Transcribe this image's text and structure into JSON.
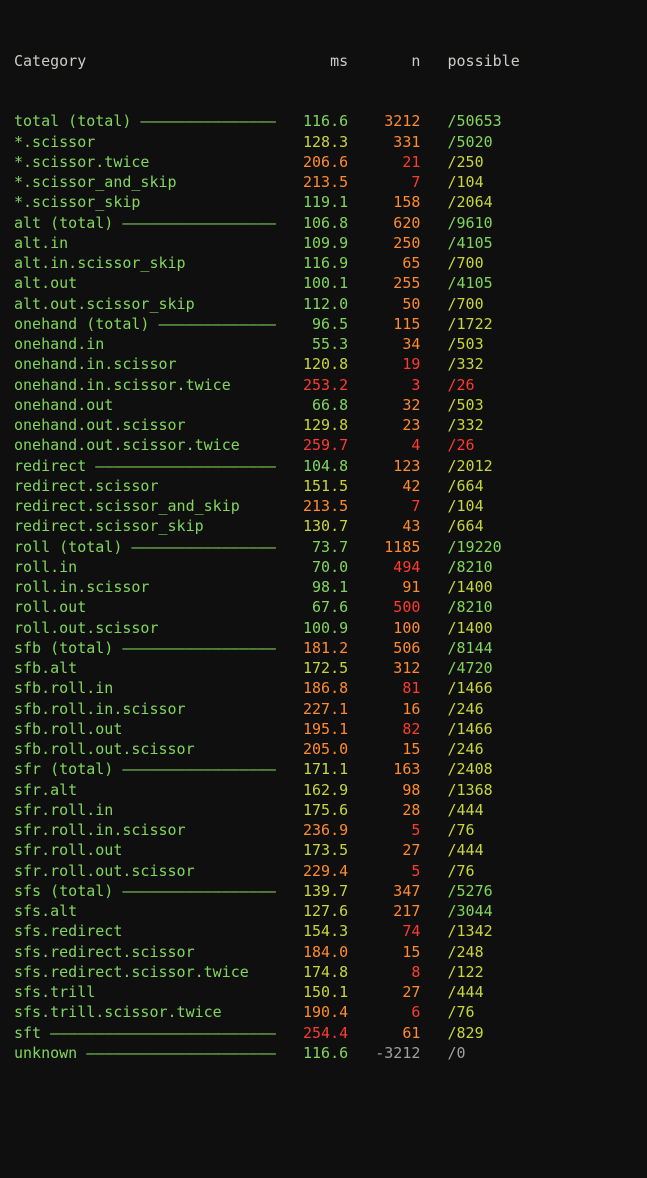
{
  "header": {
    "category": "Category",
    "ms": "ms",
    "n": "n",
    "possible": "possible"
  },
  "layout": {
    "catWidth": 29,
    "msWidth": 8,
    "nWidth": 8,
    "possPad": 3,
    "dashChar": "–"
  },
  "rows": [
    {
      "cat": "total (total)",
      "dash": true,
      "ms": "116.6",
      "msc": "#81d65c",
      "n": "3212",
      "nc": "#ff8b2e",
      "p": "/50653",
      "pc": "#81d65c"
    },
    {
      "cat": "*.scissor",
      "dash": false,
      "ms": "128.3",
      "msc": "#c9d63a",
      "n": "331",
      "nc": "#ff8b2e",
      "p": "/5020",
      "pc": "#81d65c"
    },
    {
      "cat": "*.scissor.twice",
      "dash": false,
      "ms": "206.6",
      "msc": "#ff8b2e",
      "n": "21",
      "nc": "#ff3b2e",
      "p": "/250",
      "pc": "#c9d63a"
    },
    {
      "cat": "*.scissor_and_skip",
      "dash": false,
      "ms": "213.5",
      "msc": "#ff8b2e",
      "n": "7",
      "nc": "#ff3b2e",
      "p": "/104",
      "pc": "#c9d63a"
    },
    {
      "cat": "*.scissor_skip",
      "dash": false,
      "ms": "119.1",
      "msc": "#81d65c",
      "n": "158",
      "nc": "#ff8b2e",
      "p": "/2064",
      "pc": "#c9d63a"
    },
    {
      "cat": "alt (total)",
      "dash": true,
      "ms": "106.8",
      "msc": "#81d65c",
      "n": "620",
      "nc": "#ff8b2e",
      "p": "/9610",
      "pc": "#81d65c"
    },
    {
      "cat": "alt.in",
      "dash": false,
      "ms": "109.9",
      "msc": "#81d65c",
      "n": "250",
      "nc": "#ff8b2e",
      "p": "/4105",
      "pc": "#81d65c"
    },
    {
      "cat": "alt.in.scissor_skip",
      "dash": false,
      "ms": "116.9",
      "msc": "#81d65c",
      "n": "65",
      "nc": "#ff8b2e",
      "p": "/700",
      "pc": "#c9d63a"
    },
    {
      "cat": "alt.out",
      "dash": false,
      "ms": "100.1",
      "msc": "#81d65c",
      "n": "255",
      "nc": "#ff8b2e",
      "p": "/4105",
      "pc": "#81d65c"
    },
    {
      "cat": "alt.out.scissor_skip",
      "dash": false,
      "ms": "112.0",
      "msc": "#81d65c",
      "n": "50",
      "nc": "#ff8b2e",
      "p": "/700",
      "pc": "#c9d63a"
    },
    {
      "cat": "onehand (total)",
      "dash": true,
      "ms": "96.5",
      "msc": "#81d65c",
      "n": "115",
      "nc": "#ff8b2e",
      "p": "/1722",
      "pc": "#c9d63a"
    },
    {
      "cat": "onehand.in",
      "dash": false,
      "ms": "55.3",
      "msc": "#81d65c",
      "n": "34",
      "nc": "#ff8b2e",
      "p": "/503",
      "pc": "#c9d63a"
    },
    {
      "cat": "onehand.in.scissor",
      "dash": false,
      "ms": "120.8",
      "msc": "#c9d63a",
      "n": "19",
      "nc": "#ff3b2e",
      "p": "/332",
      "pc": "#c9d63a"
    },
    {
      "cat": "onehand.in.scissor.twice",
      "dash": false,
      "ms": "253.2",
      "msc": "#ff3b2e",
      "n": "3",
      "nc": "#ff3b2e",
      "p": "/26",
      "pc": "#ff3b2e"
    },
    {
      "cat": "onehand.out",
      "dash": false,
      "ms": "66.8",
      "msc": "#81d65c",
      "n": "32",
      "nc": "#ff8b2e",
      "p": "/503",
      "pc": "#c9d63a"
    },
    {
      "cat": "onehand.out.scissor",
      "dash": false,
      "ms": "129.8",
      "msc": "#c9d63a",
      "n": "23",
      "nc": "#ff8b2e",
      "p": "/332",
      "pc": "#c9d63a"
    },
    {
      "cat": "onehand.out.scissor.twice",
      "dash": false,
      "ms": "259.7",
      "msc": "#ff3b2e",
      "n": "4",
      "nc": "#ff3b2e",
      "p": "/26",
      "pc": "#ff3b2e"
    },
    {
      "cat": "redirect",
      "dash": true,
      "ms": "104.8",
      "msc": "#81d65c",
      "n": "123",
      "nc": "#ff8b2e",
      "p": "/2012",
      "pc": "#c9d63a"
    },
    {
      "cat": "redirect.scissor",
      "dash": false,
      "ms": "151.5",
      "msc": "#c9d63a",
      "n": "42",
      "nc": "#ff8b2e",
      "p": "/664",
      "pc": "#c9d63a"
    },
    {
      "cat": "redirect.scissor_and_skip",
      "dash": false,
      "ms": "213.5",
      "msc": "#ff8b2e",
      "n": "7",
      "nc": "#ff3b2e",
      "p": "/104",
      "pc": "#c9d63a"
    },
    {
      "cat": "redirect.scissor_skip",
      "dash": false,
      "ms": "130.7",
      "msc": "#c9d63a",
      "n": "43",
      "nc": "#ff8b2e",
      "p": "/664",
      "pc": "#c9d63a"
    },
    {
      "cat": "roll (total)",
      "dash": true,
      "ms": "73.7",
      "msc": "#81d65c",
      "n": "1185",
      "nc": "#ff8b2e",
      "p": "/19220",
      "pc": "#81d65c"
    },
    {
      "cat": "roll.in",
      "dash": false,
      "ms": "70.0",
      "msc": "#81d65c",
      "n": "494",
      "nc": "#ff3b2e",
      "p": "/8210",
      "pc": "#81d65c"
    },
    {
      "cat": "roll.in.scissor",
      "dash": false,
      "ms": "98.1",
      "msc": "#81d65c",
      "n": "91",
      "nc": "#ff8b2e",
      "p": "/1400",
      "pc": "#c9d63a"
    },
    {
      "cat": "roll.out",
      "dash": false,
      "ms": "67.6",
      "msc": "#81d65c",
      "n": "500",
      "nc": "#ff3b2e",
      "p": "/8210",
      "pc": "#81d65c"
    },
    {
      "cat": "roll.out.scissor",
      "dash": false,
      "ms": "100.9",
      "msc": "#81d65c",
      "n": "100",
      "nc": "#ff8b2e",
      "p": "/1400",
      "pc": "#c9d63a"
    },
    {
      "cat": "sfb (total)",
      "dash": true,
      "ms": "181.2",
      "msc": "#ff8b2e",
      "n": "506",
      "nc": "#ff8b2e",
      "p": "/8144",
      "pc": "#81d65c"
    },
    {
      "cat": "sfb.alt",
      "dash": false,
      "ms": "172.5",
      "msc": "#c9d63a",
      "n": "312",
      "nc": "#ff8b2e",
      "p": "/4720",
      "pc": "#81d65c"
    },
    {
      "cat": "sfb.roll.in",
      "dash": false,
      "ms": "186.8",
      "msc": "#ff8b2e",
      "n": "81",
      "nc": "#ff3b2e",
      "p": "/1466",
      "pc": "#c9d63a"
    },
    {
      "cat": "sfb.roll.in.scissor",
      "dash": false,
      "ms": "227.1",
      "msc": "#ff8b2e",
      "n": "16",
      "nc": "#ff8b2e",
      "p": "/246",
      "pc": "#c9d63a"
    },
    {
      "cat": "sfb.roll.out",
      "dash": false,
      "ms": "195.1",
      "msc": "#ff8b2e",
      "n": "82",
      "nc": "#ff3b2e",
      "p": "/1466",
      "pc": "#c9d63a"
    },
    {
      "cat": "sfb.roll.out.scissor",
      "dash": false,
      "ms": "205.0",
      "msc": "#ff8b2e",
      "n": "15",
      "nc": "#ff8b2e",
      "p": "/246",
      "pc": "#c9d63a"
    },
    {
      "cat": "sfr (total)",
      "dash": true,
      "ms": "171.1",
      "msc": "#c9d63a",
      "n": "163",
      "nc": "#ff8b2e",
      "p": "/2408",
      "pc": "#c9d63a"
    },
    {
      "cat": "sfr.alt",
      "dash": false,
      "ms": "162.9",
      "msc": "#c9d63a",
      "n": "98",
      "nc": "#ff8b2e",
      "p": "/1368",
      "pc": "#c9d63a"
    },
    {
      "cat": "sfr.roll.in",
      "dash": false,
      "ms": "175.6",
      "msc": "#c9d63a",
      "n": "28",
      "nc": "#ff8b2e",
      "p": "/444",
      "pc": "#c9d63a"
    },
    {
      "cat": "sfr.roll.in.scissor",
      "dash": false,
      "ms": "236.9",
      "msc": "#ff8b2e",
      "n": "5",
      "nc": "#ff3b2e",
      "p": "/76",
      "pc": "#c9d63a"
    },
    {
      "cat": "sfr.roll.out",
      "dash": false,
      "ms": "173.5",
      "msc": "#c9d63a",
      "n": "27",
      "nc": "#ff8b2e",
      "p": "/444",
      "pc": "#c9d63a"
    },
    {
      "cat": "sfr.roll.out.scissor",
      "dash": false,
      "ms": "229.4",
      "msc": "#ff8b2e",
      "n": "5",
      "nc": "#ff3b2e",
      "p": "/76",
      "pc": "#c9d63a"
    },
    {
      "cat": "sfs (total)",
      "dash": true,
      "ms": "139.7",
      "msc": "#c9d63a",
      "n": "347",
      "nc": "#ff8b2e",
      "p": "/5276",
      "pc": "#81d65c"
    },
    {
      "cat": "sfs.alt",
      "dash": false,
      "ms": "127.6",
      "msc": "#c9d63a",
      "n": "217",
      "nc": "#ff8b2e",
      "p": "/3044",
      "pc": "#81d65c"
    },
    {
      "cat": "sfs.redirect",
      "dash": false,
      "ms": "154.3",
      "msc": "#c9d63a",
      "n": "74",
      "nc": "#ff3b2e",
      "p": "/1342",
      "pc": "#c9d63a"
    },
    {
      "cat": "sfs.redirect.scissor",
      "dash": false,
      "ms": "184.0",
      "msc": "#ff8b2e",
      "n": "15",
      "nc": "#ff8b2e",
      "p": "/248",
      "pc": "#c9d63a"
    },
    {
      "cat": "sfs.redirect.scissor.twice",
      "dash": false,
      "ms": "174.8",
      "msc": "#c9d63a",
      "n": "8",
      "nc": "#ff3b2e",
      "p": "/122",
      "pc": "#c9d63a"
    },
    {
      "cat": "sfs.trill",
      "dash": false,
      "ms": "150.1",
      "msc": "#c9d63a",
      "n": "27",
      "nc": "#ff8b2e",
      "p": "/444",
      "pc": "#c9d63a"
    },
    {
      "cat": "sfs.trill.scissor.twice",
      "dash": false,
      "ms": "190.4",
      "msc": "#ff8b2e",
      "n": "6",
      "nc": "#ff3b2e",
      "p": "/76",
      "pc": "#c9d63a"
    },
    {
      "cat": "sft",
      "dash": true,
      "ms": "254.4",
      "msc": "#ff3b2e",
      "n": "61",
      "nc": "#ff8b2e",
      "p": "/829",
      "pc": "#c9d63a"
    },
    {
      "cat": "unknown",
      "dash": true,
      "ms": "116.6",
      "msc": "#81d65c",
      "n": "-3212",
      "nc": "#a0a0a0",
      "p": "/0",
      "pc": "#a0a0a0"
    }
  ]
}
